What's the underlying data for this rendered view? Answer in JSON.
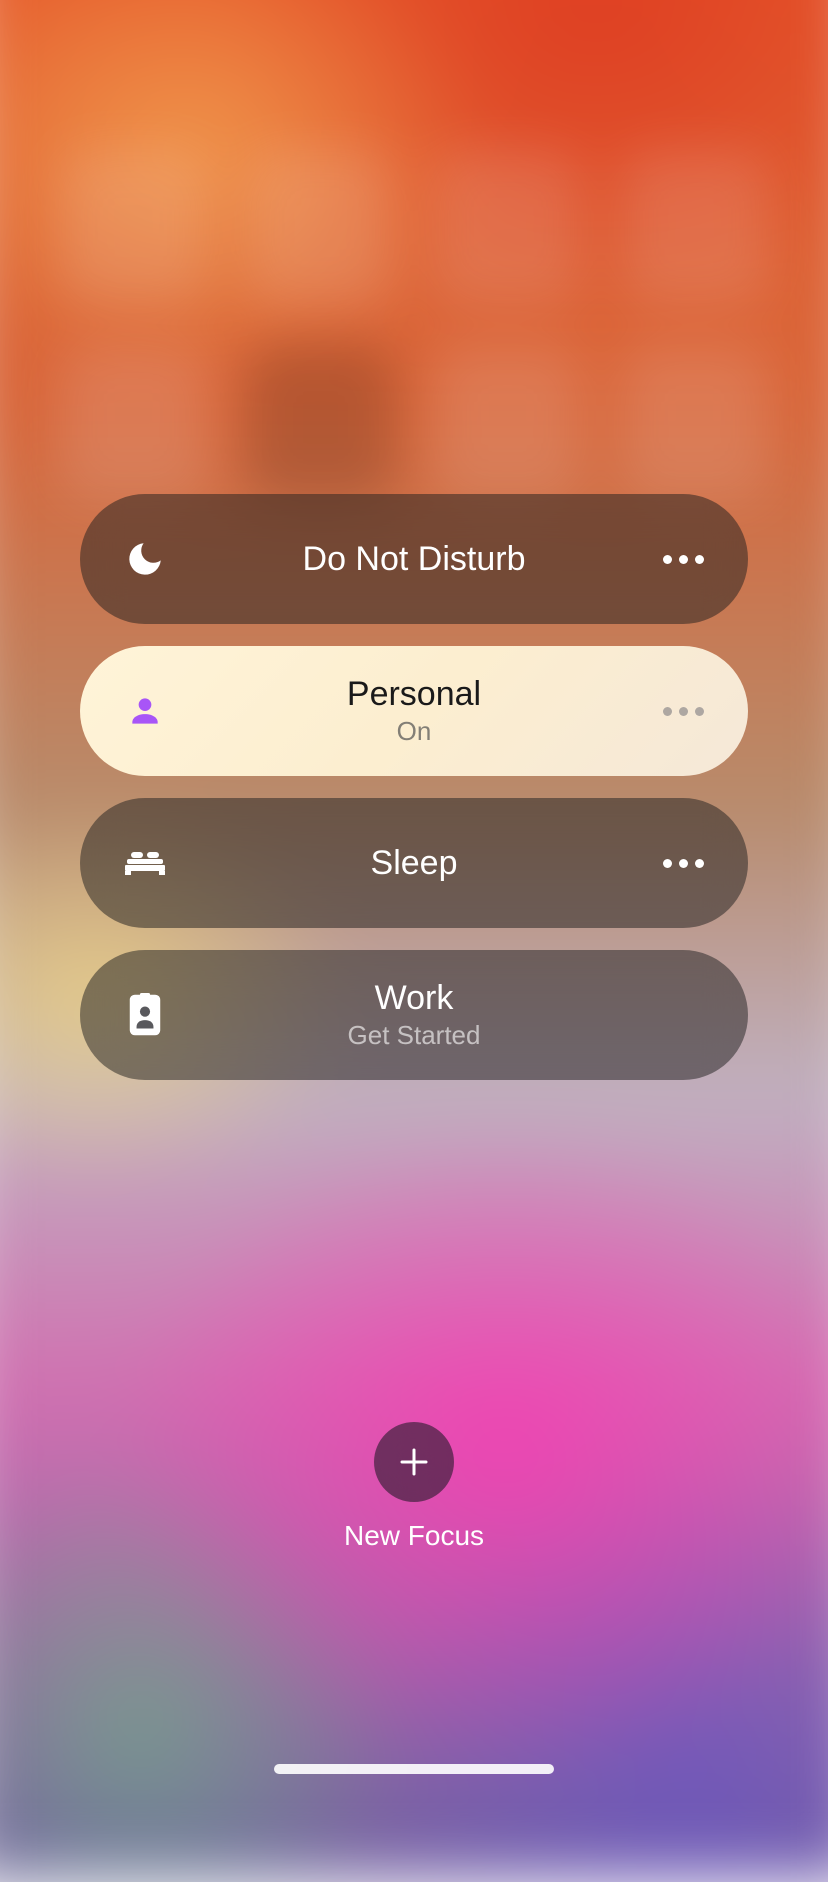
{
  "focus_modes": [
    {
      "label": "Do Not Disturb",
      "subtitle": "",
      "icon": "moon",
      "active": false,
      "has_more": true
    },
    {
      "label": "Personal",
      "subtitle": "On",
      "icon": "person",
      "active": true,
      "has_more": true
    },
    {
      "label": "Sleep",
      "subtitle": "",
      "icon": "bed",
      "active": false,
      "has_more": true
    },
    {
      "label": "Work",
      "subtitle": "Get Started",
      "icon": "badge",
      "active": false,
      "has_more": false
    }
  ],
  "new_focus_label": "New Focus",
  "colors": {
    "personal_icon": "#a855f7"
  }
}
